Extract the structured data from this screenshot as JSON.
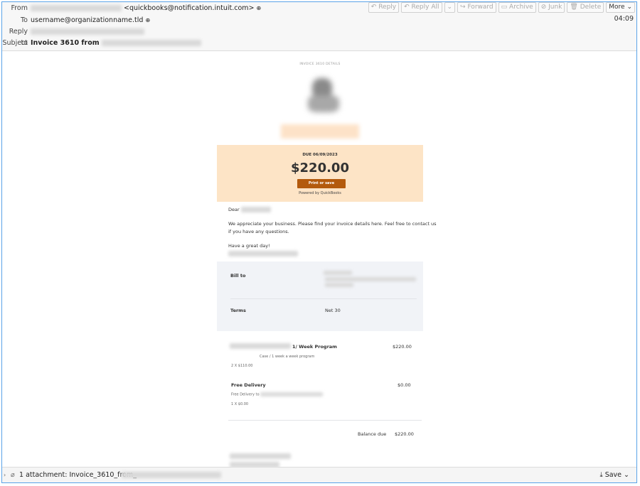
{
  "header": {
    "from_label": "From",
    "from_email": "<quickbooks@notification.intuit.com>",
    "to_label": "To",
    "to_email": "username@organizationname.tld",
    "replyto_label": "Reply to",
    "subject_label": "Subject",
    "subject": "Invoice 3610 from",
    "time": "04:09",
    "toolbar": {
      "reply": "Reply",
      "reply_all": "Reply All",
      "forward": "Forward",
      "archive": "Archive",
      "junk": "Junk",
      "delete": "Delete",
      "more": "More"
    }
  },
  "invoice": {
    "due_label": "DUE 06/09/2023",
    "amount": "$220.00",
    "print_button": "Print or save",
    "powered_by": "Powered by QuickBooks",
    "greeting": "Dear",
    "message_line1": "We appreciate your business. Please find your invoice details here. Feel free to contact us",
    "message_line2": "if you have any questions.",
    "closing": "Have a great day!",
    "bill_to_label": "Bill to",
    "terms_label": "Terms",
    "terms_value": "Net 30",
    "items": [
      {
        "name": "1/ Week Program",
        "desc": "Case / 1 week a week program",
        "qty": "2 X $110.00",
        "amount": "$220.00"
      },
      {
        "name": "Free Delivery",
        "desc": "Free Delivery to",
        "qty": "1 X $0.00",
        "amount": "$0.00"
      }
    ],
    "balance_label": "Balance due",
    "balance_value": "$220.00"
  },
  "footer": {
    "attachment": "1 attachment: Invoice_3610_from_",
    "save": "Save"
  }
}
